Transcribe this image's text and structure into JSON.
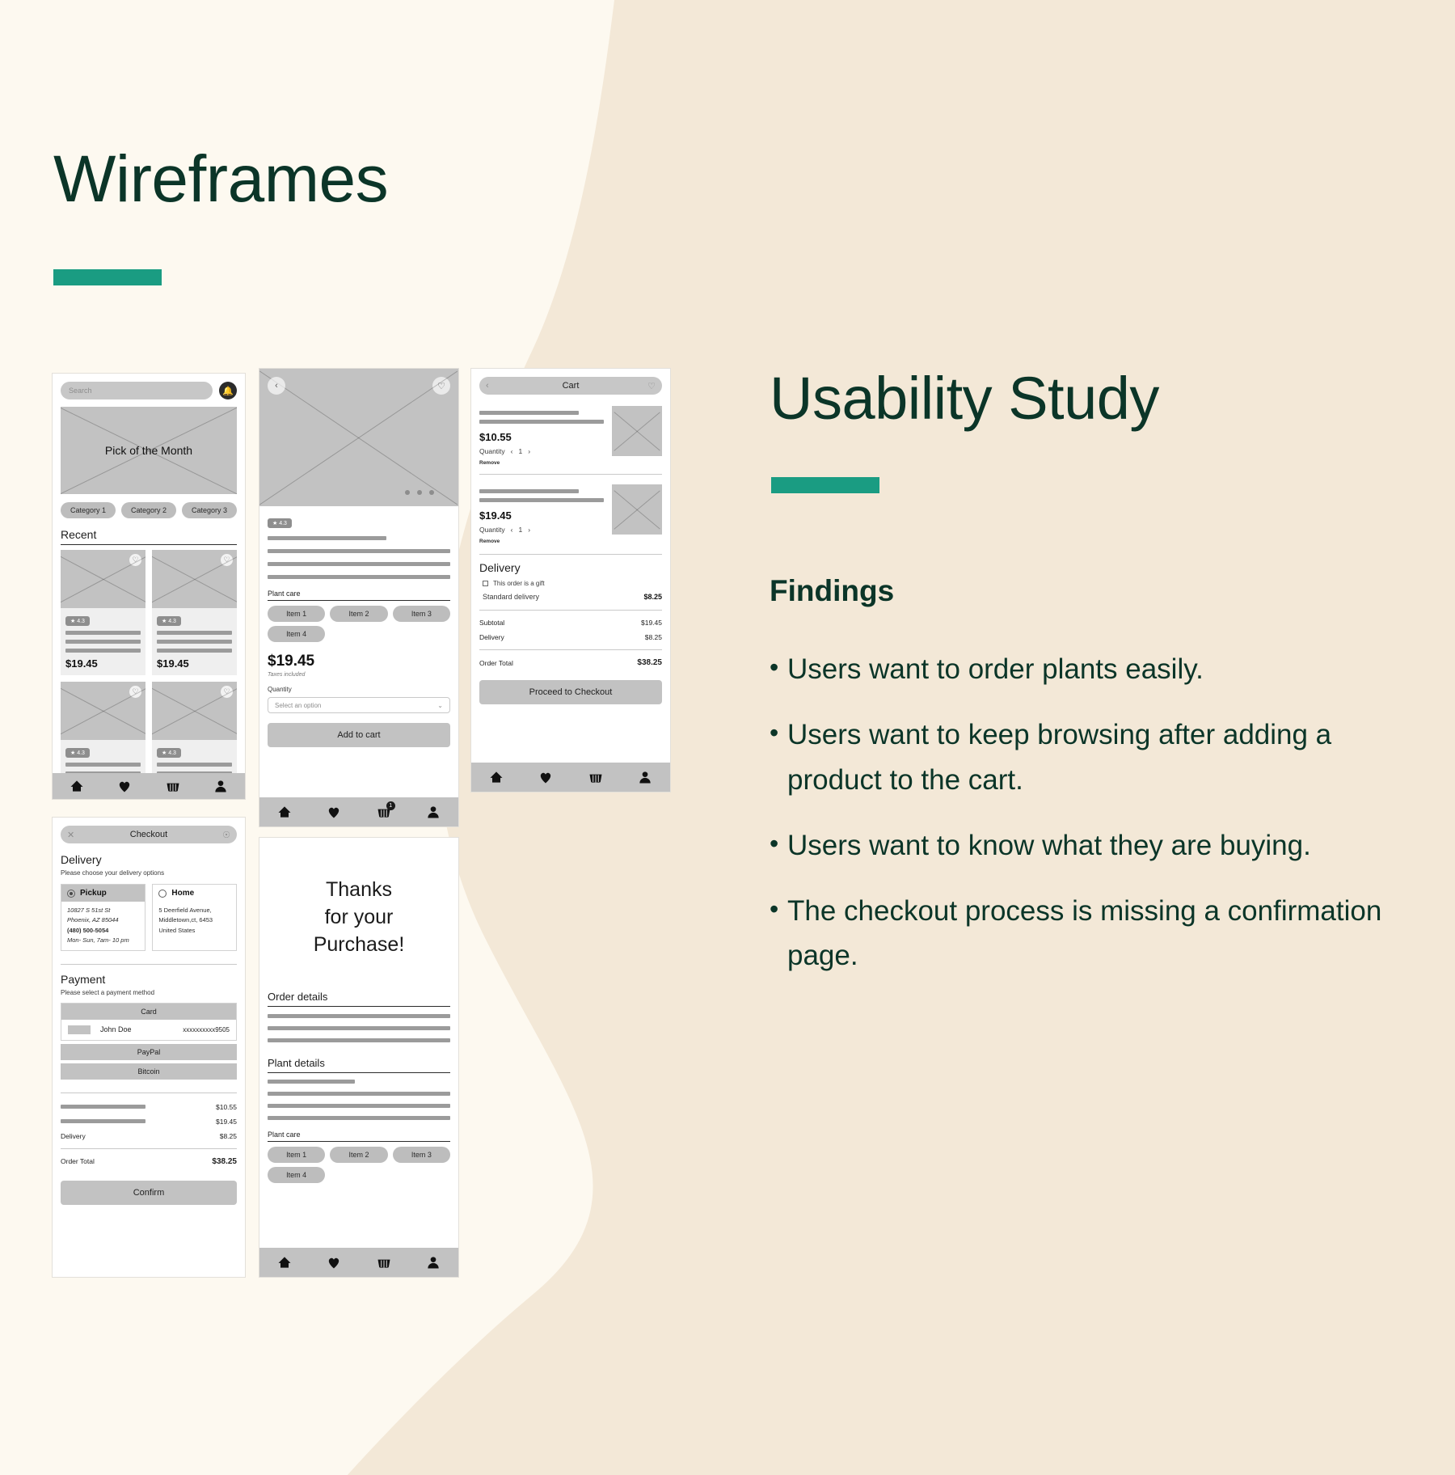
{
  "theme": {
    "bg": "#fdf9f0",
    "blob": "#f3e8d7",
    "dark_green": "#0b3528",
    "teal": "#1a9c82"
  },
  "left": {
    "title": "Wireframes"
  },
  "right": {
    "title": "Usability Study",
    "findings_heading": "Findings",
    "findings": [
      "Users want to order plants easily.",
      "Users want to keep browsing after adding a product to the cart.",
      "Users want to know what they are buying.",
      "The checkout process is missing a confirmation page."
    ]
  },
  "wireframes": {
    "home": {
      "search_placeholder": "Search",
      "bell_icon": "bell-icon",
      "hero_label": "Pick of the Month",
      "categories": [
        "Category 1",
        "Category 2",
        "Category 3"
      ],
      "section_title": "Recent",
      "rating": "★ 4.3",
      "price": "$19.45",
      "nav": [
        "home-icon",
        "heart-icon",
        "basket-icon",
        "profile-icon"
      ]
    },
    "product": {
      "back_icon": "chevron-left-icon",
      "fav_icon": "heart-icon",
      "rating": "★ 4.3",
      "care_title": "Plant care",
      "care_items": [
        "Item 1",
        "Item 2",
        "Item 3",
        "Item 4"
      ],
      "price": "$19.45",
      "tax_note": "Taxes included",
      "quantity_label": "Quantity",
      "select_placeholder": "Select an option",
      "add_to_cart": "Add to cart",
      "cart_badge": "1",
      "nav": [
        "home-icon",
        "heart-icon",
        "basket-icon",
        "profile-icon"
      ]
    },
    "cart": {
      "back_icon": "chevron-left-icon",
      "title": "Cart",
      "fav_icon": "heart-icon",
      "items": [
        {
          "price": "$10.55",
          "quantity_label": "Quantity",
          "quantity": "1",
          "remove": "Remove"
        },
        {
          "price": "$19.45",
          "quantity_label": "Quantity",
          "quantity": "1",
          "remove": "Remove"
        }
      ],
      "delivery_title": "Delivery",
      "gift_checkbox": "This order is a gift",
      "delivery_option": "Standard delivery",
      "delivery_price": "$8.25",
      "totals": [
        {
          "label": "Subtotal",
          "value": "$19.45"
        },
        {
          "label": "Delivery",
          "value": "$8.25"
        }
      ],
      "order_total_label": "Order Total",
      "order_total_value": "$38.25",
      "checkout_button": "Proceed to Checkout",
      "nav": [
        "home-icon",
        "heart-icon",
        "basket-icon",
        "profile-icon"
      ]
    },
    "checkout": {
      "close_icon": "close-icon",
      "title": "Checkout",
      "profile_icon": "profile-icon",
      "delivery_title": "Delivery",
      "delivery_subtitle": "Please choose your delivery options",
      "options": [
        {
          "name": "Pickup",
          "selected": true,
          "lines": [
            "10827 S 51st St",
            "Phoenix, AZ 85044",
            "(480) 500-5054",
            "Mon- Sun, 7am- 10 pm"
          ]
        },
        {
          "name": "Home",
          "selected": false,
          "lines": [
            "5 Deerfield Avenue,",
            "Middletown,ct, 6453",
            "United States"
          ]
        }
      ],
      "payment_title": "Payment",
      "payment_subtitle": "Please select a payment method",
      "card_header": "Card",
      "card_name": "John Doe",
      "card_number": "xxxxxxxxxx9505",
      "paypal": "PayPal",
      "bitcoin": "Bitcoin",
      "totals": [
        {
          "label": "",
          "value": "$10.55"
        },
        {
          "label": "",
          "value": "$19.45"
        },
        {
          "label": "Delivery",
          "value": "$8.25"
        }
      ],
      "order_total_label": "Order Total",
      "order_total_value": "$38.25",
      "confirm_button": "Confirm"
    },
    "confirmation": {
      "thanks_line1": "Thanks",
      "thanks_line2": "for your",
      "thanks_line3": "Purchase!",
      "order_details_title": "Order details",
      "plant_details_title": "Plant details",
      "care_title": "Plant care",
      "care_items": [
        "Item 1",
        "Item 2",
        "Item 3",
        "Item 4"
      ],
      "nav": [
        "home-icon",
        "heart-icon",
        "basket-icon",
        "profile-icon"
      ]
    }
  }
}
